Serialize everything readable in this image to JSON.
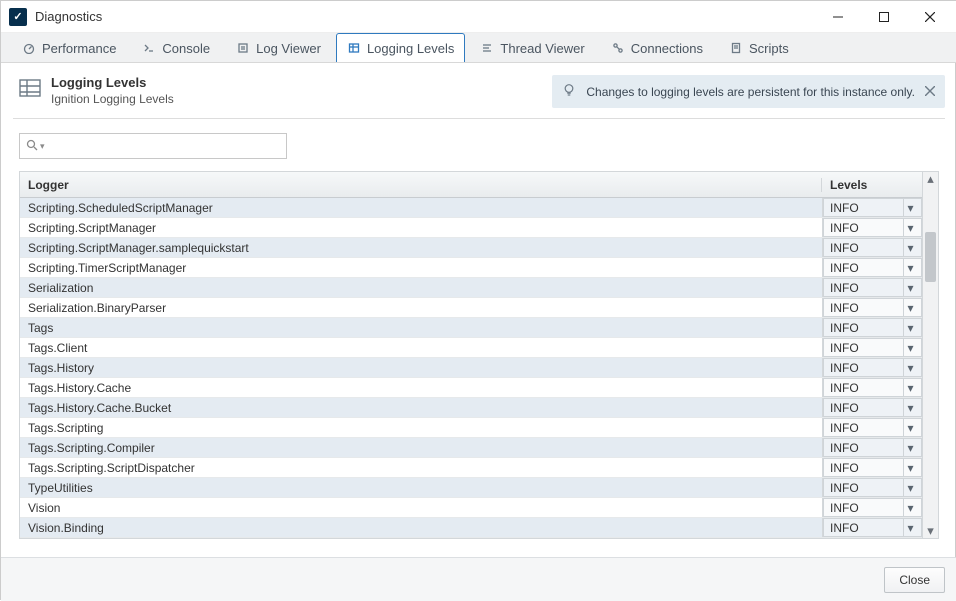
{
  "window": {
    "title": "Diagnostics"
  },
  "tabs": [
    {
      "label": "Performance",
      "active": false,
      "name": "tab-performance"
    },
    {
      "label": "Console",
      "active": false,
      "name": "tab-console"
    },
    {
      "label": "Log Viewer",
      "active": false,
      "name": "tab-log-viewer"
    },
    {
      "label": "Logging Levels",
      "active": true,
      "name": "tab-logging-levels"
    },
    {
      "label": "Thread Viewer",
      "active": false,
      "name": "tab-thread-viewer"
    },
    {
      "label": "Connections",
      "active": false,
      "name": "tab-connections"
    },
    {
      "label": "Scripts",
      "active": false,
      "name": "tab-scripts"
    }
  ],
  "header": {
    "title": "Logging Levels",
    "subtitle": "Ignition Logging Levels",
    "banner": "Changes to logging levels are persistent for this instance only."
  },
  "search": {
    "value": ""
  },
  "columns": {
    "logger": "Logger",
    "levels": "Levels"
  },
  "default_level": "INFO",
  "rows": [
    {
      "logger": "Scripting.ScheduledScriptManager",
      "level": "INFO"
    },
    {
      "logger": "Scripting.ScriptManager",
      "level": "INFO"
    },
    {
      "logger": "Scripting.ScriptManager.samplequickstart",
      "level": "INFO"
    },
    {
      "logger": "Scripting.TimerScriptManager",
      "level": "INFO"
    },
    {
      "logger": "Serialization",
      "level": "INFO"
    },
    {
      "logger": "Serialization.BinaryParser",
      "level": "INFO"
    },
    {
      "logger": "Tags",
      "level": "INFO"
    },
    {
      "logger": "Tags.Client",
      "level": "INFO"
    },
    {
      "logger": "Tags.History",
      "level": "INFO"
    },
    {
      "logger": "Tags.History.Cache",
      "level": "INFO"
    },
    {
      "logger": "Tags.History.Cache.Bucket",
      "level": "INFO"
    },
    {
      "logger": "Tags.Scripting",
      "level": "INFO"
    },
    {
      "logger": "Tags.Scripting.Compiler",
      "level": "INFO"
    },
    {
      "logger": "Tags.Scripting.ScriptDispatcher",
      "level": "INFO"
    },
    {
      "logger": "TypeUtilities",
      "level": "INFO"
    },
    {
      "logger": "Vision",
      "level": "INFO"
    },
    {
      "logger": "Vision.Binding",
      "level": "INFO"
    }
  ],
  "footer": {
    "close": "Close"
  }
}
